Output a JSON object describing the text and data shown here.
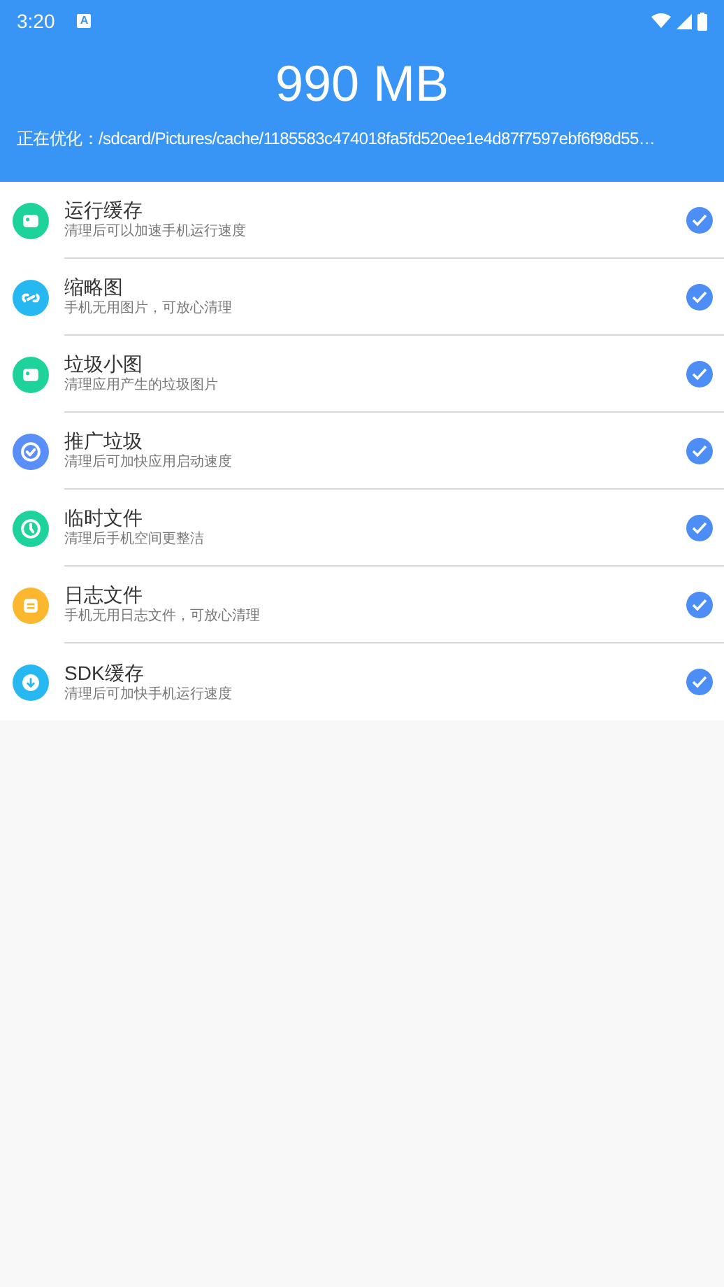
{
  "status_bar": {
    "time": "3:20",
    "notification": "A"
  },
  "header": {
    "size": "990 MB",
    "progress_label": "正在优化：/sdcard/Pictures/cache/1185583c474018fa5fd520ee1e4d87f7597ebf6f98d55…"
  },
  "items": [
    {
      "title": "运行缓存",
      "subtitle": "清理后可以加速手机运行速度",
      "kind": "photo",
      "color": "#1ed39b",
      "checked": true
    },
    {
      "title": "缩略图",
      "subtitle": "手机无用图片，可放心清理",
      "kind": "link",
      "color": "#27b8f1",
      "checked": true
    },
    {
      "title": "垃圾小图",
      "subtitle": "清理应用产生的垃圾图片",
      "kind": "photo",
      "color": "#1ed39b",
      "checked": true
    },
    {
      "title": "推广垃圾",
      "subtitle": "清理后可加快应用启动速度",
      "kind": "badge",
      "color": "#5a8ef8",
      "checked": true
    },
    {
      "title": "临时文件",
      "subtitle": "清理后手机空间更整洁",
      "kind": "clock",
      "color": "#1ed39b",
      "checked": true
    },
    {
      "title": "日志文件",
      "subtitle": "手机无用日志文件，可放心清理",
      "kind": "list",
      "color": "#fbb82e",
      "checked": true
    },
    {
      "title": "SDK缓存",
      "subtitle": "清理后可加快手机运行速度",
      "kind": "download",
      "color": "#27b8f1",
      "checked": true
    }
  ]
}
